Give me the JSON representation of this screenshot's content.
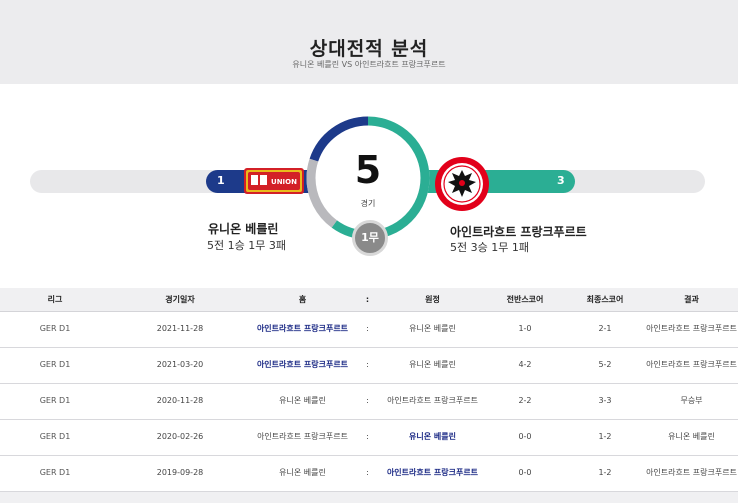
{
  "header": {
    "title": "상대전적 분석",
    "subtitle": "유니온 베를린 VS 아인트라흐트 프랑크푸르트"
  },
  "summary": {
    "total_games": "5",
    "games_label": "경기",
    "home_wins": "1",
    "away_wins": "3",
    "draws": "1무",
    "home_win_fraction": 0.2,
    "away_win_fraction": 0.6,
    "draw_fraction": 0.2,
    "home": {
      "name": "유니온 베를린",
      "record": "5전 1승 1무 3패",
      "logo_text": "UNION",
      "color": "#1d3a8a"
    },
    "away": {
      "name": "아인트라흐트 프랑크푸르트",
      "record": "5전 3승 1무 1패",
      "color": "#2bae94"
    }
  },
  "table": {
    "headers": [
      "리그",
      "경기일자",
      "홈",
      ":",
      "원정",
      "전반스코어",
      "최종스코어",
      "결과"
    ],
    "rows": [
      {
        "league": "GER D1",
        "date": "2021-11-28",
        "home": "아인트라흐트 프랑크푸르트",
        "sep": ":",
        "away": "유니온 베를린",
        "half": "1-0",
        "final": "2-1",
        "result": "아인트라흐트 프랑크푸르트",
        "winner": "home"
      },
      {
        "league": "GER D1",
        "date": "2021-03-20",
        "home": "아인트라흐트 프랑크푸르트",
        "sep": ":",
        "away": "유니온 베를린",
        "half": "4-2",
        "final": "5-2",
        "result": "아인트라흐트 프랑크푸르트",
        "winner": "home"
      },
      {
        "league": "GER D1",
        "date": "2020-11-28",
        "home": "유니온 베를린",
        "sep": ":",
        "away": "아인트라흐트 프랑크푸르트",
        "half": "2-2",
        "final": "3-3",
        "result": "무승부",
        "winner": "none"
      },
      {
        "league": "GER D1",
        "date": "2020-02-26",
        "home": "아인트라흐트 프랑크푸르트",
        "sep": ":",
        "away": "유니온 베를린",
        "half": "0-0",
        "final": "1-2",
        "result": "유니온 베를린",
        "winner": "away"
      },
      {
        "league": "GER D1",
        "date": "2019-09-28",
        "home": "유니온 베를린",
        "sep": ":",
        "away": "아인트라흐트 프랑크푸르트",
        "half": "0-0",
        "final": "1-2",
        "result": "아인트라흐트 프랑크푸르트",
        "winner": "away"
      }
    ]
  }
}
